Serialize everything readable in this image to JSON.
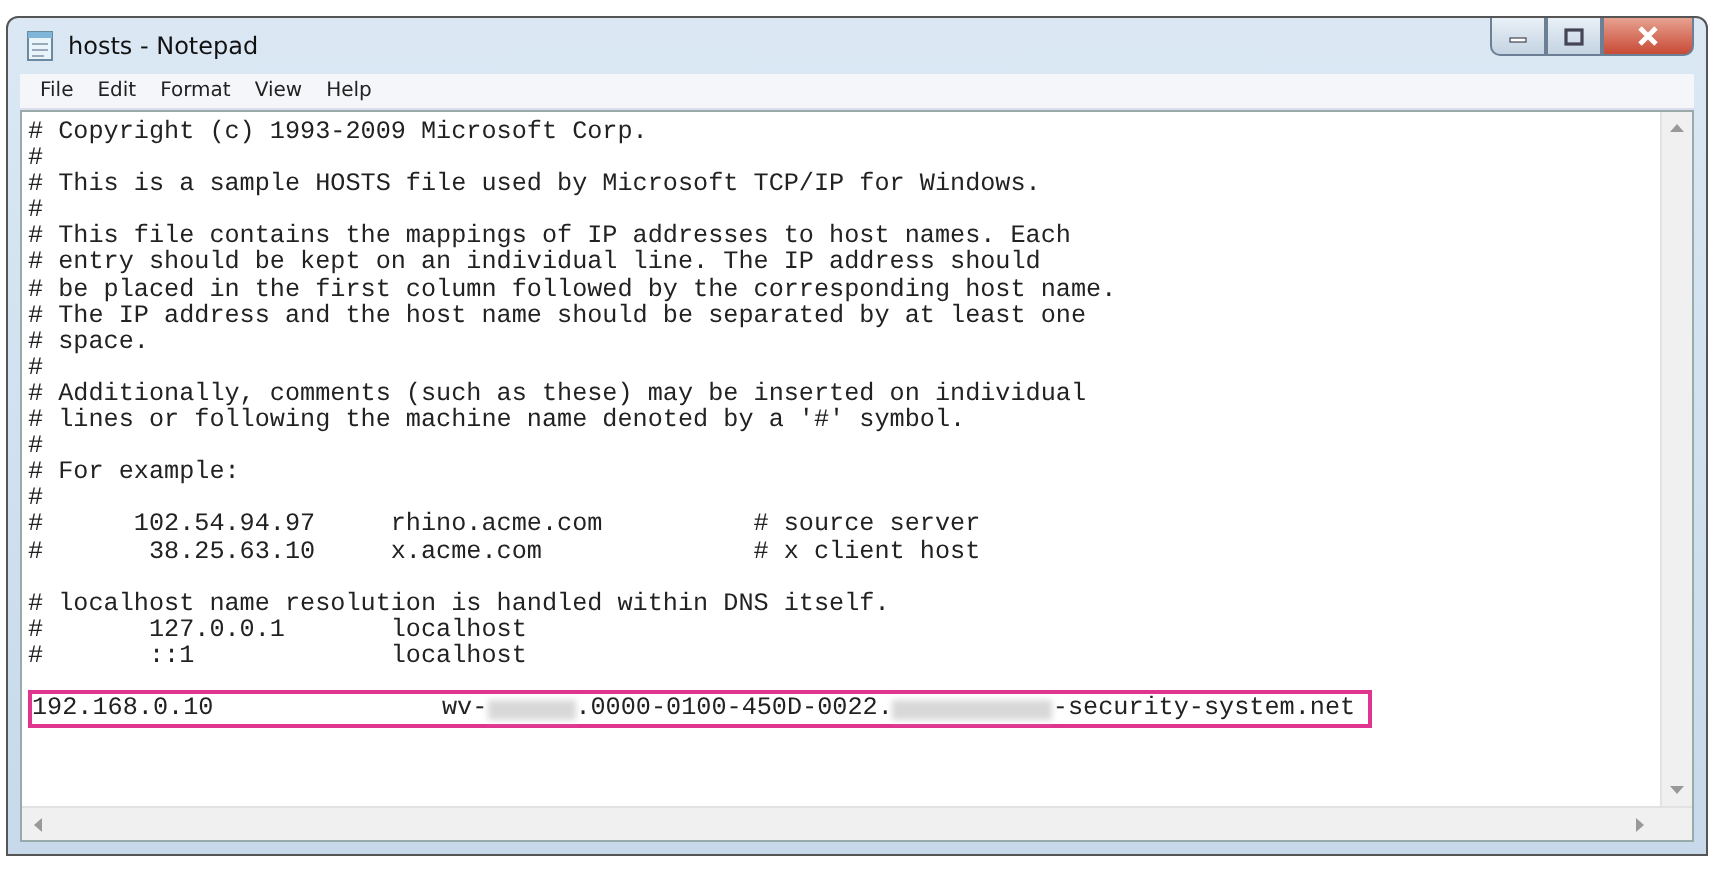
{
  "window": {
    "title": "hosts - Notepad"
  },
  "menu": [
    "File",
    "Edit",
    "Format",
    "View",
    "Help"
  ],
  "lines": [
    {
      "text": "# Copyright (c) 1993-2009 Microsoft Corp.",
      "gap_before": false
    },
    {
      "text": "#",
      "gap_before": false
    },
    {
      "text": "# This is a sample HOSTS file used by Microsoft TCP/IP for Windows.",
      "gap_before": false
    },
    {
      "text": "#",
      "gap_before": false
    },
    {
      "text": "# This file contains the mappings of IP addresses to host names. Each",
      "gap_before": false
    },
    {
      "text": "# entry should be kept on an individual line. The IP address should",
      "gap_before": false
    },
    {
      "text": "# be placed in the first column followed by the corresponding host name.",
      "gap_before": false
    },
    {
      "text": "# The IP address and the host name should be separated by at least one",
      "gap_before": false
    },
    {
      "text": "# space.",
      "gap_before": false
    },
    {
      "text": "#",
      "gap_before": false
    },
    {
      "text": "# Additionally, comments (such as these) may be inserted on individual",
      "gap_before": false
    },
    {
      "text": "# lines or following the machine name denoted by a '#' symbol.",
      "gap_before": false
    },
    {
      "text": "#",
      "gap_before": false
    },
    {
      "text": "# For example:",
      "gap_before": false
    },
    {
      "text": "#",
      "gap_before": false
    },
    {
      "text": "#      102.54.94.97     rhino.acme.com          # source server",
      "gap_before": false
    },
    {
      "text": "#       38.25.63.10     x.acme.com              # x client host",
      "gap_before": false
    },
    {
      "text": "# localhost name resolution is handled within DNS itself.",
      "gap_before": true
    },
    {
      "text": "#       127.0.0.1       localhost",
      "gap_before": false
    },
    {
      "text": "#       ::1             localhost",
      "gap_before": false
    }
  ],
  "highlighted_entry": {
    "ip": "192.168.0.10",
    "host_parts": [
      {
        "kind": "text",
        "text": "wv-"
      },
      {
        "kind": "redacted"
      },
      {
        "kind": "text",
        "text": ".0000-0100-450D-0022."
      },
      {
        "kind": "redacted"
      },
      {
        "kind": "text",
        "text": "-security-system.net"
      }
    ]
  }
}
